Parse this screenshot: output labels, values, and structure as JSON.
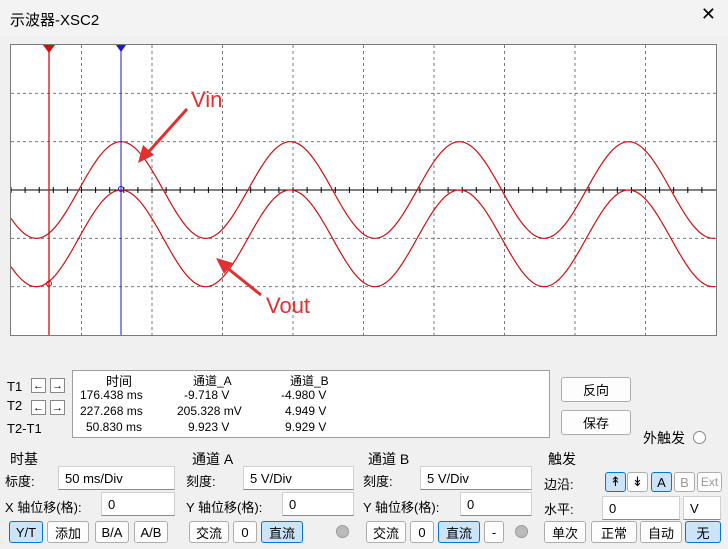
{
  "window": {
    "title": "示波器-XSC2",
    "close_glyph": "✕"
  },
  "plot": {
    "annotations": {
      "vin": "Vin",
      "vout": "Vout"
    },
    "colors": {
      "trace": "#cc1111",
      "annot": "#e03030",
      "cursor1": "#cc1111",
      "cursor2": "#1a1acc",
      "grid": "#7a7a7a"
    },
    "divisions": {
      "x": 10,
      "y": 6
    },
    "vin_waveform": {
      "amplitude_div": 1.0,
      "offset_div": 0,
      "period_div": 2.4,
      "cursor_ms": 227.268
    },
    "vout_waveform": {
      "amplitude_div": 1.0,
      "offset_div": -1.0,
      "period_div": 2.4
    }
  },
  "cursors": {
    "t1": {
      "label": "T1",
      "left": "←",
      "right": "→"
    },
    "t2": {
      "label": "T2",
      "left": "←",
      "right": "→"
    },
    "diff": {
      "label": "T2-T1"
    }
  },
  "readout": {
    "headers": [
      "时间",
      "通道_A",
      "通道_B"
    ],
    "rows": [
      [
        "176.438 ms",
        "-9.718 V",
        "-4.980 V"
      ],
      [
        "227.268 ms",
        "205.328 mV",
        "4.949 V"
      ],
      [
        "50.830 ms",
        "9.923 V",
        "9.929 V"
      ]
    ]
  },
  "actions": {
    "reverse": "反向",
    "save": "保存",
    "ext_trigger": "外触发"
  },
  "timebase": {
    "header": "时基",
    "scale_label": "标度:",
    "scale_value": "50 ms/Div",
    "xpos_label": "X 轴位移(格):",
    "xpos_value": "0",
    "modes": [
      "Y/T",
      "添加",
      "B/A",
      "A/B"
    ]
  },
  "channel_a": {
    "header": "通道 A",
    "scale_label": "刻度:",
    "scale_value": "5  V/Div",
    "ypos_label": "Y 轴位移(格):",
    "ypos_value": "0",
    "coupling": [
      "交流",
      "0",
      "直流"
    ]
  },
  "channel_b": {
    "header": "通道 B",
    "scale_label": "刻度:",
    "scale_value": "5  V/Div",
    "ypos_label": "Y 轴位移(格):",
    "ypos_value": "0",
    "coupling": [
      "交流",
      "0",
      "直流",
      "-"
    ]
  },
  "trigger": {
    "header": "触发",
    "edge_label": "边沿:",
    "edge_rise": "↟",
    "edge_fall": "↡",
    "sources": [
      "A",
      "B",
      "Ext"
    ],
    "level_label": "水平:",
    "level_value": "0",
    "level_unit": "V",
    "modes": [
      "单次",
      "正常",
      "自动",
      "无"
    ]
  }
}
